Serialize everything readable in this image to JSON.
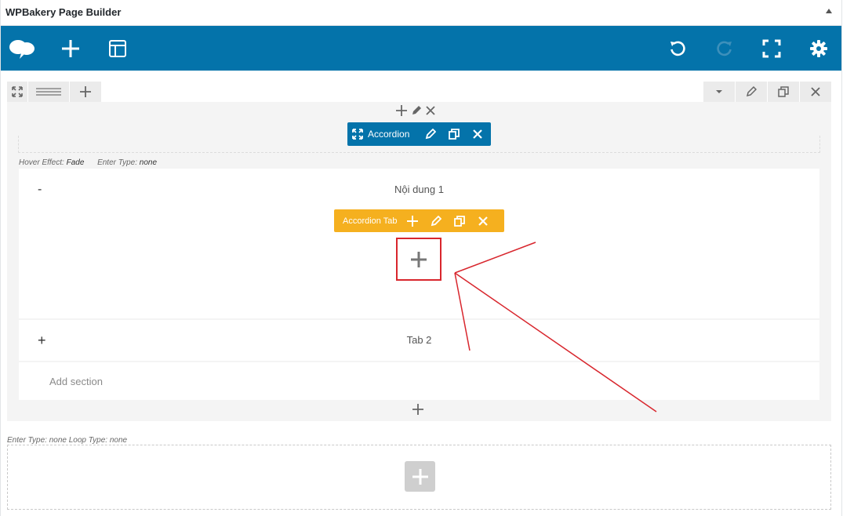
{
  "panel": {
    "title": "WPBakery Page Builder"
  },
  "icons": {
    "logo": "cloud-logo-icon",
    "add": "plus-icon",
    "templates": "layout-icon",
    "undo": "undo-icon",
    "redo": "redo-icon",
    "fullscreen": "fullscreen-icon",
    "settings": "gear-icon"
  },
  "accordion": {
    "label": "Accordion",
    "meta_hover_key": "Hover Effect:",
    "meta_hover_value": "Fade",
    "meta_enter_key": "Enter Type:",
    "meta_enter_value": "none",
    "sections": [
      {
        "toggle": "-",
        "title": "Nội dung 1"
      },
      {
        "toggle": "+",
        "title": "Tab 2"
      }
    ],
    "tab_label": "Accordion Tab",
    "add_section": "Add section"
  },
  "lower": {
    "meta": "Enter Type: none  Loop Type: none"
  },
  "colors": {
    "toolbar": "#0473aa",
    "tab": "#f5b01f",
    "highlight": "#d8262d"
  }
}
